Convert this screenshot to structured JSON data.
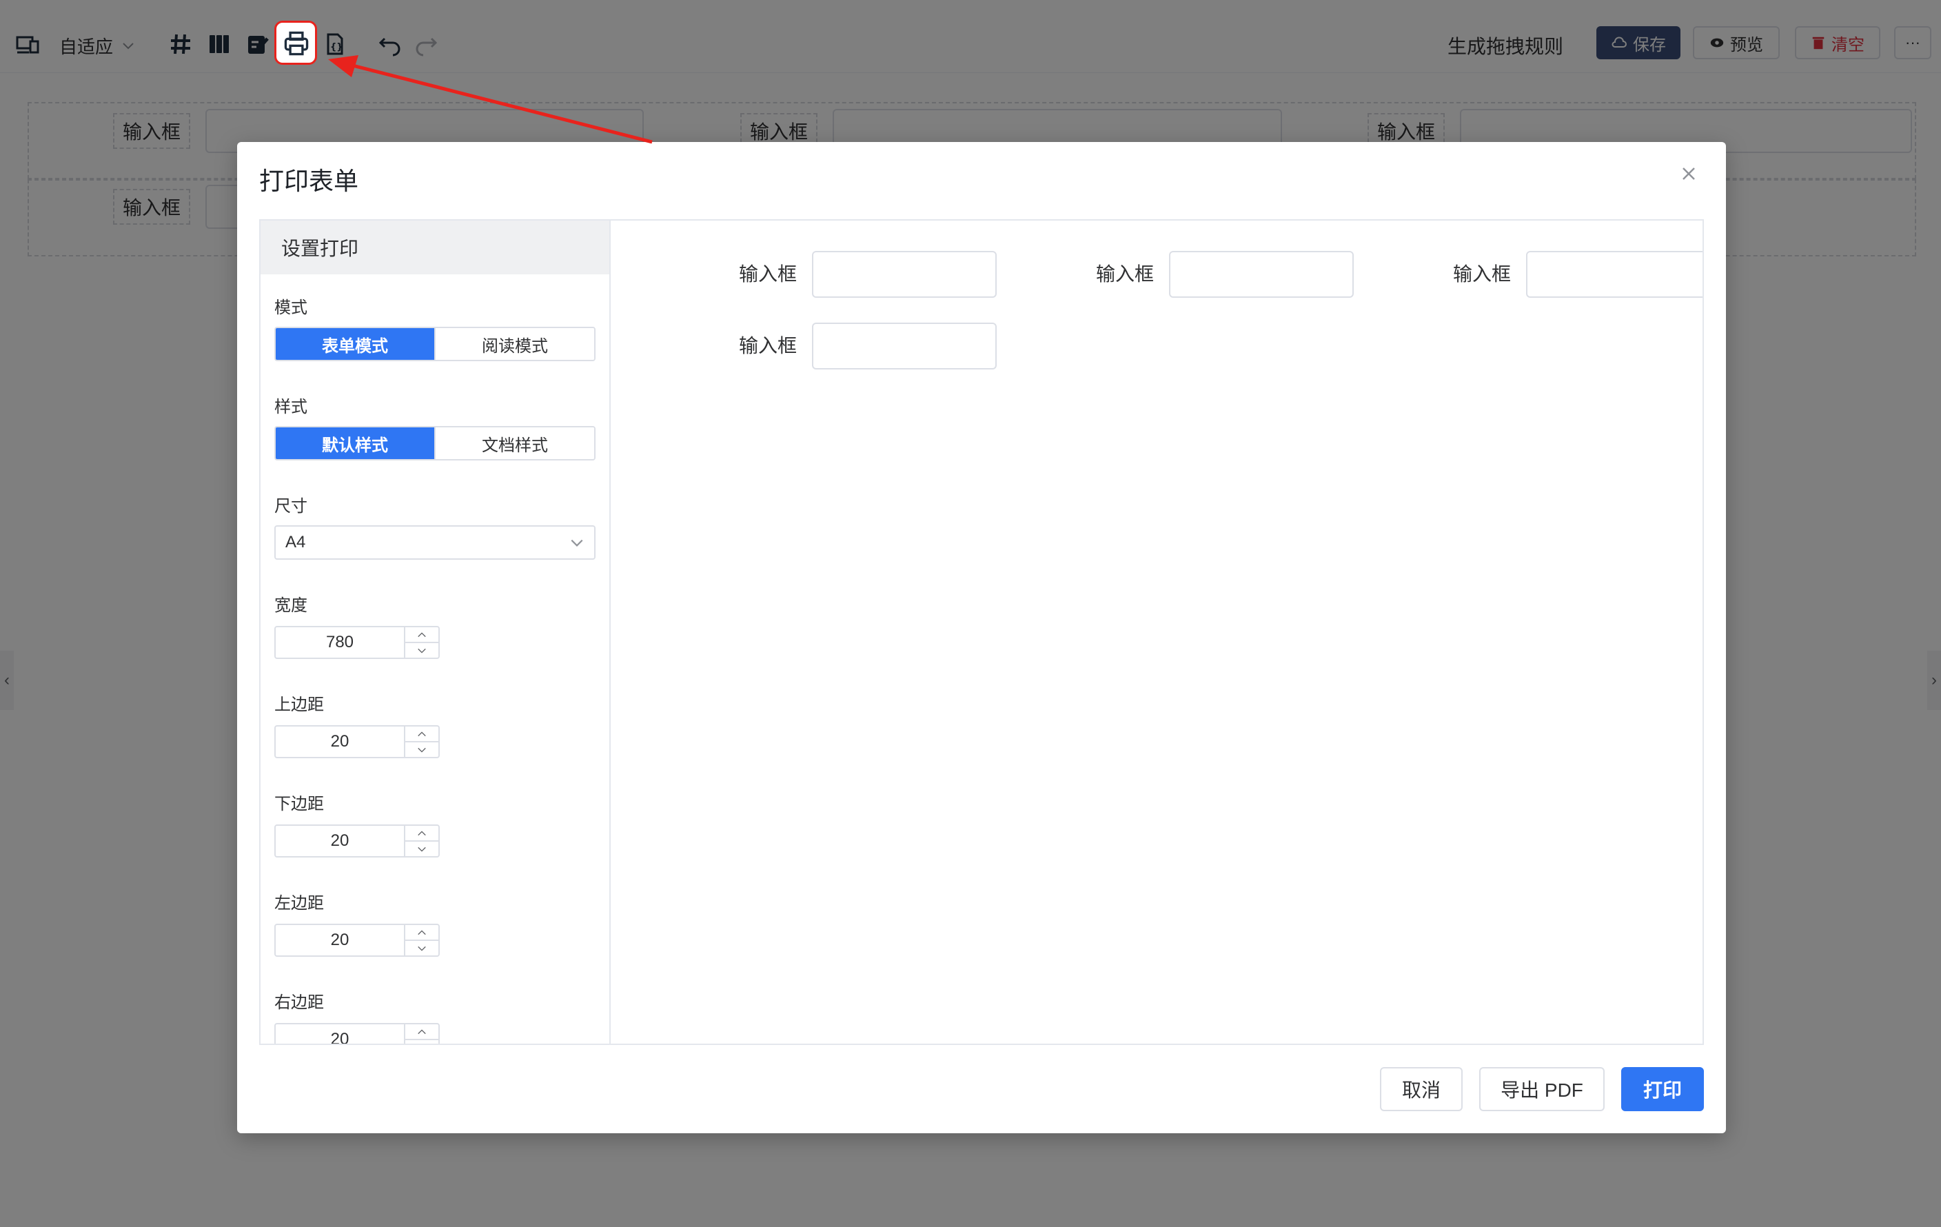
{
  "toolbar": {
    "layout_mode": "自适应",
    "generate_rules": "生成拖拽规则",
    "save": "保存",
    "preview": "预览",
    "clear": "清空",
    "more": "···",
    "colors": {
      "save_bg": "#3a4d78",
      "clear_color": "#e0303f"
    }
  },
  "canvas": {
    "field_label": "输入框"
  },
  "dialog": {
    "title": "打印表单",
    "settings_title": "设置打印",
    "mode_label": "模式",
    "mode_options": [
      "表单模式",
      "阅读模式"
    ],
    "mode_selected": "表单模式",
    "style_label": "样式",
    "style_options": [
      "默认样式",
      "文档样式"
    ],
    "style_selected": "默认样式",
    "size_label": "尺寸",
    "size_value": "A4",
    "width_label": "宽度",
    "width_value": "780",
    "top_margin_label": "上边距",
    "top_margin_value": "20",
    "bottom_margin_label": "下边距",
    "bottom_margin_value": "20",
    "left_margin_label": "左边距",
    "left_margin_value": "20",
    "right_margin_label": "右边距",
    "right_margin_value": "20",
    "preview_fields": [
      "输入框",
      "输入框",
      "输入框",
      "输入框"
    ],
    "cancel": "取消",
    "export_pdf": "导出 PDF",
    "print": "打印",
    "accent": "#2f76f3"
  },
  "annotation": {
    "highlight_color": "#e8231d"
  }
}
